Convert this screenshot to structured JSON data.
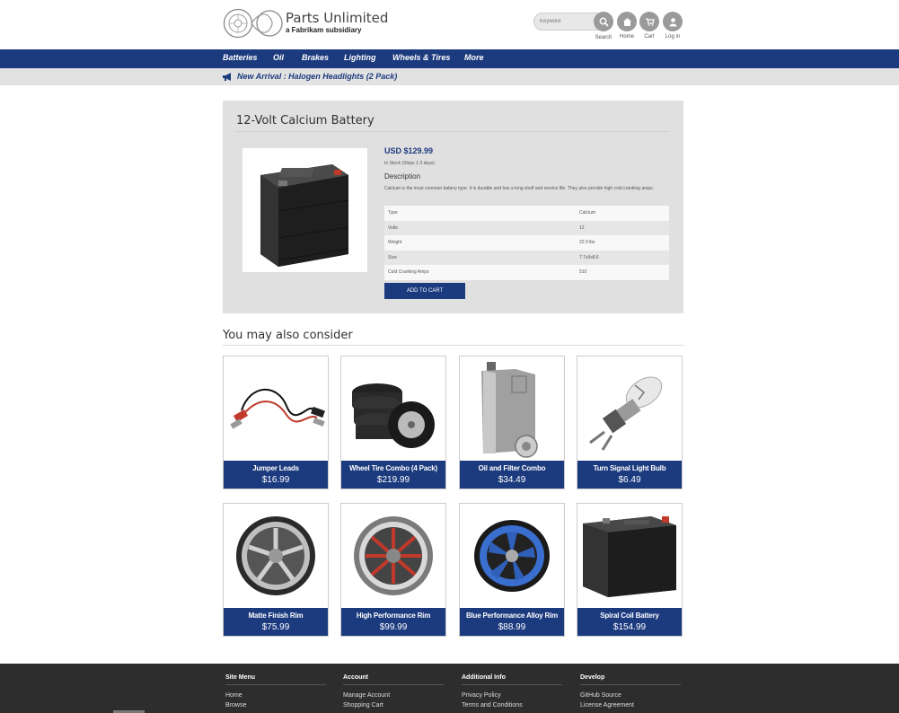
{
  "brand": {
    "title": "Parts Unlimited",
    "subtitle": "a Fabrikam subsidiary"
  },
  "header": {
    "search_placeholder": "Keyword",
    "search_label": "Search",
    "home_label": "Home",
    "cart_label": "Cart",
    "login_label": "Log in"
  },
  "nav": {
    "items": [
      "Batteries",
      "Oil",
      "Brakes",
      "Lighting",
      "Wheels & Tires",
      "More"
    ]
  },
  "announcement": "New Arrival : Halogen Headlights (2 Pack)",
  "product": {
    "title": "12-Volt Calcium Battery",
    "price": "USD $129.99",
    "stock": "In Stock (Ships 1-3 days)",
    "description_heading": "Description",
    "description": "Calcium is the most common battery type. It is durable and has a long shelf and service life. They also provide high cold cranking amps.",
    "specs": [
      {
        "label": "Type",
        "value": "Calcium"
      },
      {
        "label": "Volts",
        "value": "12"
      },
      {
        "label": "Weight",
        "value": "22.9 lbs"
      },
      {
        "label": "Size",
        "value": "7.7x5x8.6"
      },
      {
        "label": "Cold Cranking Amps",
        "value": "510"
      }
    ],
    "add_to_cart": "ADD TO CART"
  },
  "recommendations": {
    "title": "You may also consider",
    "items": [
      {
        "name": "Jumper Leads",
        "price": "$16.99",
        "icon": "jumper-leads"
      },
      {
        "name": "Wheel Tire Combo (4 Pack)",
        "price": "$219.99",
        "icon": "tires"
      },
      {
        "name": "Oil and Filter Combo",
        "price": "$34.49",
        "icon": "oil-can"
      },
      {
        "name": "Turn Signal Light Bulb",
        "price": "$6.49",
        "icon": "bulb"
      },
      {
        "name": "Matte Finish Rim",
        "price": "$75.99",
        "icon": "rim-gray"
      },
      {
        "name": "High Performance Rim",
        "price": "$99.99",
        "icon": "rim-red"
      },
      {
        "name": "Blue Performance Alloy Rim",
        "price": "$88.99",
        "icon": "rim-blue"
      },
      {
        "name": "Spiral Coil Battery",
        "price": "$154.99",
        "icon": "battery"
      }
    ]
  },
  "footer": {
    "columns": [
      {
        "heading": "Site Menu",
        "links": [
          "Home",
          "Browse"
        ]
      },
      {
        "heading": "Account",
        "links": [
          "Manage Account",
          "Shopping Cart"
        ]
      },
      {
        "heading": "Additional Info",
        "links": [
          "Privacy Policy",
          "Terms and Conditions"
        ]
      },
      {
        "heading": "Develop",
        "links": [
          "GitHub Source",
          "License Agreement"
        ]
      }
    ]
  },
  "colors": {
    "accent": "#1c3a7e",
    "panel": "#e0e0e0",
    "footer": "#2d2d2d"
  }
}
